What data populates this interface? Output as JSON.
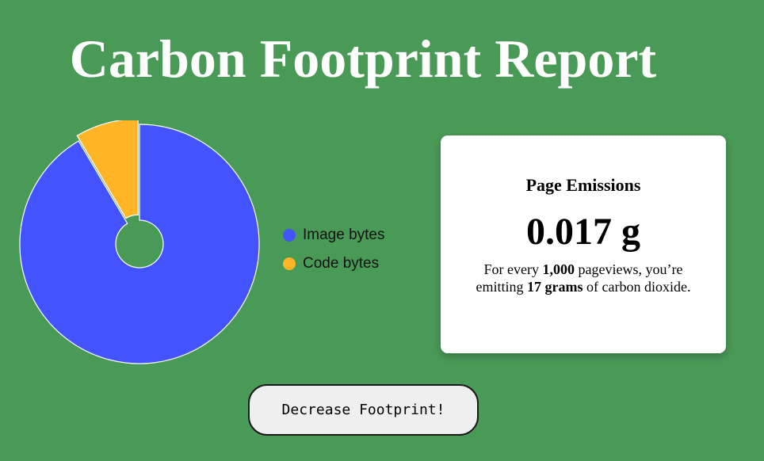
{
  "header": {
    "title": "Carbon Footprint Report"
  },
  "chart_data": {
    "type": "pie",
    "categories": [
      "Image bytes",
      "Code bytes"
    ],
    "values": [
      91.5,
      8.5
    ],
    "colors": [
      "#4353ff",
      "#ffb526"
    ],
    "legend_position": "right",
    "donut": true
  },
  "legend": {
    "items": [
      {
        "label": "Image bytes",
        "color": "#4353ff"
      },
      {
        "label": "Code bytes",
        "color": "#ffb526"
      }
    ]
  },
  "emissions_card": {
    "heading": "Page Emissions",
    "value": "0.017 g",
    "desc_1": "For every ",
    "desc_pageviews": "1,000",
    "desc_2": " pageviews, you’re emitting ",
    "desc_grams": "17 grams",
    "desc_3": " of carbon dioxide."
  },
  "action": {
    "label": "Decrease Footprint!"
  },
  "colors": {
    "background": "#4a9a57",
    "card": "#ffffff",
    "title": "#ffffff"
  }
}
